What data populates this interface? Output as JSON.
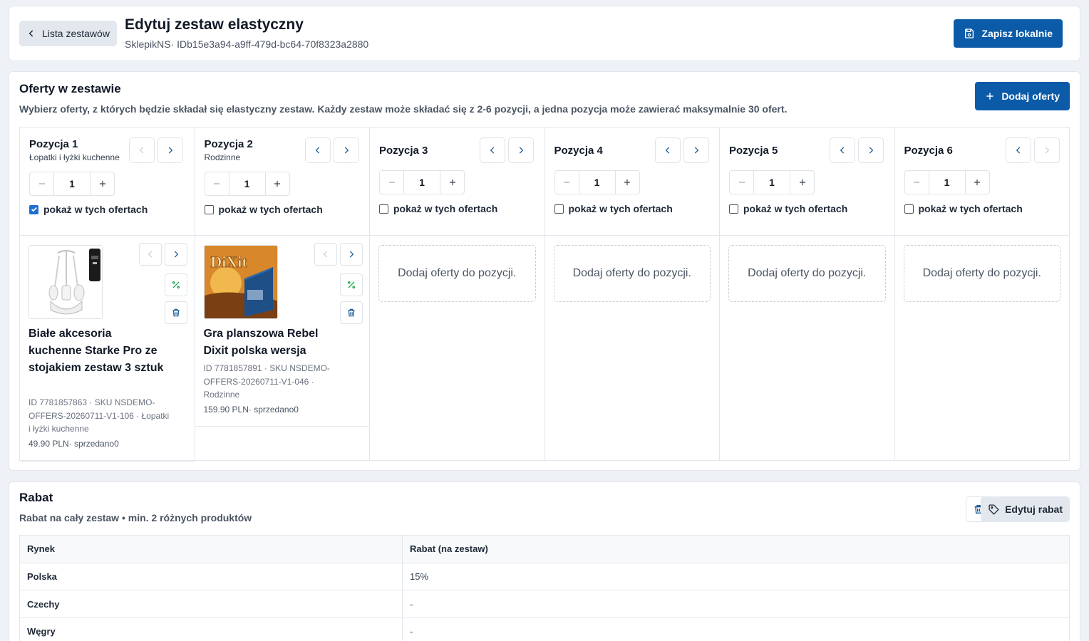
{
  "header": {
    "back_label": "Lista zestawów",
    "title": "Edytuj zestaw elastyczny",
    "subtitle": "SklepikNS· IDb15e3a94-a9ff-479d-bc64-70f8323a2880",
    "save_label": "Zapisz lokalnie"
  },
  "offers": {
    "title": "Oferty w zestawie",
    "description": "Wybierz oferty, z których będzie składał się elastyczny zestaw. Każdy zestaw może składać się z 2-6 pozycji, a jedna pozycja może zawierać maksymalnie 30 ofert.",
    "add_label": "Dodaj oferty",
    "checkbox_label": "pokaż w tych ofertach",
    "empty_label": "Dodaj oferty do pozycji.",
    "positions": [
      {
        "name": "Pozycja 1",
        "category": "Łopatki i łyżki kuchenne",
        "qty": "1",
        "show": true
      },
      {
        "name": "Pozycja 2",
        "category": "Rodzinne",
        "qty": "1",
        "show": false
      },
      {
        "name": "Pozycja 3",
        "category": "",
        "qty": "1",
        "show": false
      },
      {
        "name": "Pozycja 4",
        "category": "",
        "qty": "1",
        "show": false
      },
      {
        "name": "Pozycja 5",
        "category": "",
        "qty": "1",
        "show": false
      },
      {
        "name": "Pozycja 6",
        "category": "",
        "qty": "1",
        "show": false
      }
    ],
    "items": [
      {
        "title": "Białe akcesoria kuchenne Starke Pro ze stojakiem zestaw 3 sztuk",
        "meta": "ID 7781857863 · SKU NSDEMO-OFFERS-20260711-V1-106 · Łopatki i łyżki kuchenne",
        "price": "49.90 PLN· sprzedano0"
      },
      {
        "title": "Gra planszowa Rebel Dixit polska wersja",
        "meta": "ID 7781857891 · SKU NSDEMO-OFFERS-20260711-V1-046 · Rodzinne",
        "price": "159.90 PLN· sprzedano0",
        "logo_text": "DiXit"
      }
    ]
  },
  "rabat": {
    "title": "Rabat",
    "description": "Rabat na cały zestaw • min. 2 różnych produktów",
    "edit_label": "Edytuj rabat",
    "columns": [
      "Rynek",
      "Rabat (na zestaw)"
    ],
    "rows": [
      [
        "Polska",
        "15%"
      ],
      [
        "Czechy",
        "-"
      ],
      [
        "Węgry",
        "-"
      ]
    ]
  },
  "colors": {
    "primary": "#0b5ba8",
    "percent_icon": "#16a34a",
    "checkbox": "#1f6fd1"
  }
}
